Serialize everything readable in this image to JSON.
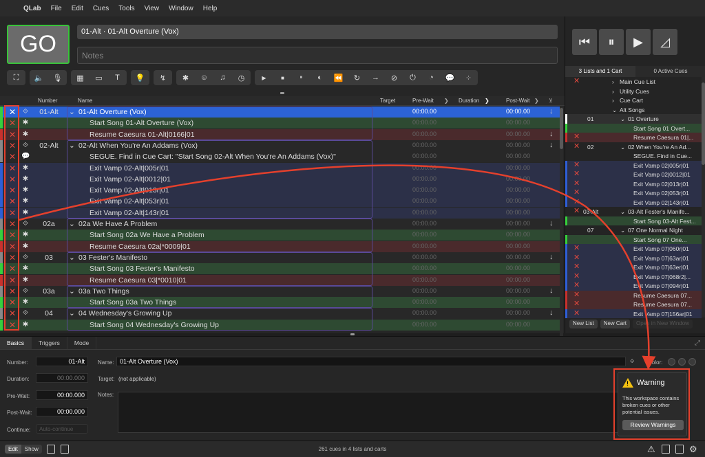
{
  "menu": {
    "app": "QLab",
    "items": [
      "File",
      "Edit",
      "Cues",
      "Tools",
      "View",
      "Window",
      "Help"
    ]
  },
  "header": {
    "go_label": "GO",
    "current_cue": "01-Alt · 01-Alt Overture (Vox)",
    "notes_placeholder": "Notes"
  },
  "toolbar": {
    "groups": [
      [
        "group-icon"
      ],
      [
        "audio-icon",
        "mic-icon"
      ],
      [
        "video-icon",
        "camera-icon",
        "text-icon"
      ],
      [
        "light-icon"
      ],
      [
        "network-icon"
      ],
      [
        "midi-icon",
        "timecode-icon",
        "music-icon",
        "clock-icon"
      ],
      [
        "start-icon",
        "stop-icon",
        "pause-icon",
        "load-icon",
        "reset-icon",
        "devamp-icon",
        "goto-icon",
        "target-icon",
        "arm-icon",
        "wait-icon",
        "memo-icon",
        "script-icon"
      ]
    ]
  },
  "columns": {
    "number": "Number",
    "name": "Name",
    "target": "Target",
    "prewait": "Pre-Wait",
    "duration": "Duration",
    "postwait": "Post-Wait"
  },
  "cues": [
    {
      "number": "01-Alt",
      "name": "01-Alt Overture (Vox)",
      "indent": 0,
      "group": true,
      "pre": "00:00.00",
      "post": "00:00.00",
      "arrow": true,
      "color": "#36d03c",
      "bg": "#2c63d6",
      "selected": true
    },
    {
      "number": "",
      "name": "Start Song 01-Alt Overture (Vox)",
      "indent": 1,
      "group": false,
      "pre": "00:00.00",
      "post": "00:00.00",
      "arrow": false,
      "color": "#36d03c",
      "bg": "#2e4a32"
    },
    {
      "number": "",
      "name": "Resume Caesura 01-Alt|0166|01",
      "indent": 1,
      "group": false,
      "pre": "00:00.00",
      "post": "00:00.00",
      "arrow": true,
      "color": "#c8312d",
      "bg": "#4a2a2c"
    },
    {
      "number": "02-Alt",
      "name": "02-Alt When You're An Addams (Vox)",
      "indent": 0,
      "group": true,
      "pre": "00:00.00",
      "post": "00:00.00",
      "arrow": true,
      "color": "#888888",
      "bg": "#282828"
    },
    {
      "number": "",
      "name": "SEGUE. Find in Cue Cart: \"Start Song 02-Alt When You're An Addams (Vox)\"",
      "indent": 1,
      "group": false,
      "pre": "00:00.00",
      "post": "00:00.00",
      "arrow": false,
      "color": "#888888",
      "bg": "#282828"
    },
    {
      "number": "",
      "name": "Exit Vamp 02-Alt|005r|01",
      "indent": 1,
      "group": false,
      "pre": "00:00.00",
      "post": "00:00.00",
      "arrow": false,
      "color": "#2e5ed6",
      "bg": "#2c3048"
    },
    {
      "number": "",
      "name": "Exit Vamp 02-Alt|0012|01",
      "indent": 1,
      "group": false,
      "pre": "00:00.00",
      "post": "00:00.00",
      "arrow": false,
      "color": "#2e5ed6",
      "bg": "#2c3048"
    },
    {
      "number": "",
      "name": "Exit Vamp 02-Alt|013r|01",
      "indent": 1,
      "group": false,
      "pre": "00:00.00",
      "post": "00:00.00",
      "arrow": false,
      "color": "#2e5ed6",
      "bg": "#2c3048"
    },
    {
      "number": "",
      "name": "Exit Vamp 02-Alt|053r|01",
      "indent": 1,
      "group": false,
      "pre": "00:00.00",
      "post": "00:00.00",
      "arrow": false,
      "color": "#2e5ed6",
      "bg": "#2c3048"
    },
    {
      "number": "",
      "name": "Exit Vamp 02-Alt|143r|01",
      "indent": 1,
      "group": false,
      "pre": "00:00.00",
      "post": "00:00.00",
      "arrow": false,
      "color": "#2e5ed6",
      "bg": "#2c3048"
    },
    {
      "number": "02a",
      "name": "02a We Have A Problem",
      "indent": 0,
      "group": true,
      "pre": "00:00.00",
      "post": "00:00.00",
      "arrow": true,
      "color": "#888888",
      "bg": "#282828"
    },
    {
      "number": "",
      "name": "Start Song 02a We Have a Problem",
      "indent": 1,
      "group": false,
      "pre": "00:00.00",
      "post": "00:00.00",
      "arrow": false,
      "color": "#36d03c",
      "bg": "#2e4a32"
    },
    {
      "number": "",
      "name": "Resume Caesura 02a|*0009|01",
      "indent": 1,
      "group": false,
      "pre": "00:00.00",
      "post": "00:00.00",
      "arrow": false,
      "color": "#c8312d",
      "bg": "#4a2a2c"
    },
    {
      "number": "03",
      "name": "03 Fester's Manifesto",
      "indent": 0,
      "group": true,
      "pre": "00:00.00",
      "post": "00:00.00",
      "arrow": true,
      "color": "#888888",
      "bg": "#282828"
    },
    {
      "number": "",
      "name": "Start Song 03 Fester's Manifesto",
      "indent": 1,
      "group": false,
      "pre": "00:00.00",
      "post": "00:00.00",
      "arrow": false,
      "color": "#36d03c",
      "bg": "#2e4a32"
    },
    {
      "number": "",
      "name": "Resume Caesura 03|*0010|01",
      "indent": 1,
      "group": false,
      "pre": "00:00.00",
      "post": "00:00.00",
      "arrow": false,
      "color": "#c8312d",
      "bg": "#4a2a2c"
    },
    {
      "number": "03a",
      "name": "03a Two Things",
      "indent": 0,
      "group": true,
      "pre": "00:00.00",
      "post": "00:00.00",
      "arrow": true,
      "color": "#888888",
      "bg": "#282828"
    },
    {
      "number": "",
      "name": "Start Song 03a Two Things",
      "indent": 1,
      "group": false,
      "pre": "00:00.00",
      "post": "00:00.00",
      "arrow": false,
      "color": "#36d03c",
      "bg": "#2e4a32"
    },
    {
      "number": "04",
      "name": "04 Wednesday's Growing Up",
      "indent": 0,
      "group": true,
      "pre": "00:00.00",
      "post": "00:00.00",
      "arrow": true,
      "color": "#888888",
      "bg": "#282828"
    },
    {
      "number": "",
      "name": "Start Song 04 Wednesday's Growing Up",
      "indent": 1,
      "group": false,
      "pre": "00:00.00",
      "post": "00:00.00",
      "arrow": false,
      "color": "#36d03c",
      "bg": "#2e4a32"
    }
  ],
  "right_panel": {
    "tab_lists": "3 Lists and 1 Cart",
    "tab_active": "0 Active Cues",
    "rows": [
      {
        "number": "",
        "name": "Main Cue List",
        "level": 0,
        "x": true,
        "color": "",
        "bg": "#242424",
        "caret": ">"
      },
      {
        "number": "",
        "name": "Utility Cues",
        "level": 0,
        "x": false,
        "color": "",
        "bg": "#242424",
        "caret": ">"
      },
      {
        "number": "",
        "name": "Cue Cart",
        "level": 0,
        "x": false,
        "color": "",
        "bg": "#242424",
        "caret": ">"
      },
      {
        "number": "",
        "name": "Alt Songs",
        "level": 0,
        "x": false,
        "color": "",
        "bg": "#242424",
        "caret": "v"
      },
      {
        "number": "01",
        "name": "01 Overture",
        "level": 1,
        "x": false,
        "color": "#ffffff",
        "bg": "#303030",
        "caret": "v"
      },
      {
        "number": "",
        "name": "Start Song 01 Overt...",
        "level": 2,
        "x": false,
        "color": "#36d03c",
        "bg": "#2e4a32",
        "caret": ""
      },
      {
        "number": "",
        "name": "Resume Caesura 01|...",
        "level": 2,
        "x": true,
        "color": "#c8312d",
        "bg": "#4a2a2c",
        "caret": ""
      },
      {
        "number": "02",
        "name": "02 When You're An Ad...",
        "level": 1,
        "x": true,
        "color": "",
        "bg": "#242424",
        "caret": "v"
      },
      {
        "number": "",
        "name": "SEGUE. Find in Cue...",
        "level": 2,
        "x": false,
        "color": "",
        "bg": "#242424",
        "caret": ""
      },
      {
        "number": "",
        "name": "Exit Vamp 02|005r|01",
        "level": 2,
        "x": true,
        "color": "#2e5ed6",
        "bg": "#2c3048",
        "caret": ""
      },
      {
        "number": "",
        "name": "Exit Vamp 02|0012|01",
        "level": 2,
        "x": true,
        "color": "#2e5ed6",
        "bg": "#2c3048",
        "caret": ""
      },
      {
        "number": "",
        "name": "Exit Vamp 02|013r|01",
        "level": 2,
        "x": true,
        "color": "#2e5ed6",
        "bg": "#2c3048",
        "caret": ""
      },
      {
        "number": "",
        "name": "Exit Vamp 02|053r|01",
        "level": 2,
        "x": true,
        "color": "#2e5ed6",
        "bg": "#2c3048",
        "caret": ""
      },
      {
        "number": "",
        "name": "Exit Vamp 02|143r|01",
        "level": 2,
        "x": true,
        "color": "#2e5ed6",
        "bg": "#2c3048",
        "caret": ""
      },
      {
        "number": "03-Alt",
        "name": "03-Alt Fester's Manife...",
        "level": 1,
        "x": true,
        "color": "",
        "bg": "#242424",
        "caret": "v"
      },
      {
        "number": "",
        "name": "Start Song 03-Alt Fest...",
        "level": 2,
        "x": false,
        "color": "#36d03c",
        "bg": "#2e4a32",
        "caret": ""
      },
      {
        "number": "07",
        "name": "07 One Normal Night",
        "level": 1,
        "x": false,
        "color": "",
        "bg": "#242424",
        "caret": "v"
      },
      {
        "number": "",
        "name": "Start Song 07 One...",
        "level": 2,
        "x": false,
        "color": "#36d03c",
        "bg": "#2e4a32",
        "caret": ""
      },
      {
        "number": "",
        "name": "Exit Vamp 07|060r|01",
        "level": 2,
        "x": true,
        "color": "#2e5ed6",
        "bg": "#2c3048",
        "caret": ""
      },
      {
        "number": "",
        "name": "Exit Vamp 07|63ar|01",
        "level": 2,
        "x": true,
        "color": "#2e5ed6",
        "bg": "#2c3048",
        "caret": ""
      },
      {
        "number": "",
        "name": "Exit Vamp 07|63er|01",
        "level": 2,
        "x": true,
        "color": "#2e5ed6",
        "bg": "#2c3048",
        "caret": ""
      },
      {
        "number": "",
        "name": "Exit Vamp 07|068r2|...",
        "level": 2,
        "x": true,
        "color": "#2e5ed6",
        "bg": "#2c3048",
        "caret": ""
      },
      {
        "number": "",
        "name": "Exit Vamp 07|094r|01",
        "level": 2,
        "x": true,
        "color": "#2e5ed6",
        "bg": "#2c3048",
        "caret": ""
      },
      {
        "number": "",
        "name": "Resume Caesura 07...",
        "level": 2,
        "x": true,
        "color": "#c8312d",
        "bg": "#4a2a2c",
        "caret": ""
      },
      {
        "number": "",
        "name": "Resume Caesura 07...",
        "level": 2,
        "x": true,
        "color": "#c8312d",
        "bg": "#4a2a2c",
        "caret": ""
      },
      {
        "number": "",
        "name": "Exit Vamp 07|156ar|01",
        "level": 2,
        "x": true,
        "color": "#2e5ed6",
        "bg": "#2c3048",
        "caret": ""
      }
    ],
    "new_list": "New List",
    "new_cart": "New Cart",
    "open_window": "Open in New Window"
  },
  "inspector": {
    "tabs": [
      "Basics",
      "Triggers",
      "Mode"
    ],
    "number_label": "Number:",
    "number_value": "01-Alt",
    "name_label": "Name:",
    "name_value": "01-Alt Overture (Vox)",
    "color_label": "Color:",
    "duration_label": "Duration:",
    "duration_value": "00:00.000",
    "target_label": "Target:",
    "target_value": "(not applicable)",
    "prewait_label": "Pre-Wait:",
    "prewait_value": "00:00.000",
    "notes_label": "Notes:",
    "postwait_label": "Post-Wait:",
    "postwait_value": "00:00.000",
    "continue_label": "Continue:",
    "continue_value": "Auto-continue"
  },
  "warning": {
    "title": "Warning",
    "message": "This workspace contains broken cues or other potential issues.",
    "button": "Review Warnings"
  },
  "status": {
    "edit": "Edit",
    "show": "Show",
    "count": "261 cues in 4 lists and carts"
  },
  "colors": {
    "go_border": "#39c43a",
    "selected_row": "#2c63d6",
    "broken_x": "#e2493e",
    "annotation": "#e5402c",
    "warning_icon": "#f5c211"
  }
}
